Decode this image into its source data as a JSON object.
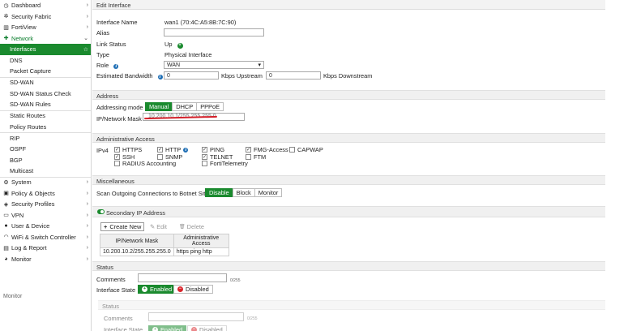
{
  "sidebar": {
    "items": [
      {
        "label": "Dashboard",
        "icon": "dashboard-icon",
        "glyph": "◷",
        "chev": "›"
      },
      {
        "label": "Security Fabric",
        "icon": "fabric-icon",
        "glyph": "✲",
        "chev": "›"
      },
      {
        "label": "FortiView",
        "icon": "chart-icon",
        "glyph": "▥",
        "chev": "›"
      },
      {
        "label": "Network",
        "icon": "network-plus-icon",
        "glyph": "✚",
        "chev": "⌄"
      },
      {
        "label": "Interfaces",
        "star": "☆"
      },
      {
        "label": "DNS"
      },
      {
        "label": "Packet Capture"
      },
      {
        "label": "SD-WAN"
      },
      {
        "label": "SD-WAN Status Check"
      },
      {
        "label": "SD-WAN Rules"
      },
      {
        "label": "Static Routes"
      },
      {
        "label": "Policy Routes"
      },
      {
        "label": "RIP"
      },
      {
        "label": "OSPF"
      },
      {
        "label": "BGP"
      },
      {
        "label": "Multicast"
      },
      {
        "label": "System",
        "icon": "gear-icon",
        "glyph": "⚙",
        "chev": "›"
      },
      {
        "label": "Policy & Objects",
        "icon": "policy-icon",
        "glyph": "▣",
        "chev": "›"
      },
      {
        "label": "Security Profiles",
        "icon": "shield-icon",
        "glyph": "◈",
        "chev": "›"
      },
      {
        "label": "VPN",
        "icon": "monitor-icon",
        "glyph": "▭",
        "chev": "›"
      },
      {
        "label": "User & Device",
        "icon": "user-icon",
        "glyph": "●",
        "chev": "›"
      },
      {
        "label": "WiFi & Switch Controller",
        "icon": "wifi-icon",
        "glyph": "◠",
        "chev": "›"
      },
      {
        "label": "Log & Report",
        "icon": "bar-chart-icon",
        "glyph": "▤",
        "chev": "›"
      },
      {
        "label": "Monitor",
        "icon": "gauge-icon",
        "glyph": "◕",
        "chev": "›"
      }
    ],
    "ghost_monitor": "Monitor"
  },
  "edit": {
    "title": "Edit Interface",
    "interface_name_label": "Interface Name",
    "interface_name_value": "wan1 (70:4C:A5:8B:7C:90)",
    "alias_label": "Alias",
    "alias_value": "",
    "link_status_label": "Link Status",
    "link_status_value": "Up",
    "type_label": "Type",
    "type_value": "Physical Interface",
    "role_label": "Role",
    "role_value": "WAN",
    "bandwidth_label": "Estimated Bandwidth",
    "upstream_value": "0",
    "upstream_unit": "Kbps Upstream",
    "downstream_value": "0",
    "downstream_unit": "Kbps Downstream"
  },
  "address": {
    "section": "Address",
    "mode_label": "Addressing mode",
    "modes": [
      "Manual",
      "DHCP",
      "PPPoE"
    ],
    "ipmask_label": "IP/Network Mask",
    "ipmask_value": "10.200.10.1/255.255.255.0"
  },
  "admin": {
    "section": "Administrative Access",
    "ipv4_label": "IPv4",
    "checks": [
      {
        "label": "HTTPS",
        "checked": true
      },
      {
        "label": "HTTP",
        "checked": true,
        "info": true
      },
      {
        "label": "PING",
        "checked": true
      },
      {
        "label": "FMG-Access",
        "checked": true
      },
      {
        "label": "CAPWAP",
        "checked": false
      },
      {
        "label": "SSH",
        "checked": true
      },
      {
        "label": "SNMP",
        "checked": false
      },
      {
        "label": "TELNET",
        "checked": true
      },
      {
        "label": "FTM",
        "checked": false
      },
      {
        "label": "RADIUS Accounting",
        "checked": false
      },
      {
        "label": "FortiTelemetry",
        "checked": false
      }
    ],
    "check_mark": "✓"
  },
  "misc": {
    "section": "Miscellaneous",
    "botnet_label": "Scan Outgoing Connections to Botnet Sites",
    "options": [
      "Disable",
      "Block",
      "Monitor"
    ]
  },
  "secondary": {
    "section": "Secondary IP Address",
    "create_label": "Create New",
    "edit_label": "Edit",
    "delete_label": "Delete",
    "plus": "+",
    "pencil": "✎",
    "trash": "🗑",
    "columns": [
      "IP/Network Mask",
      "Administrative Access"
    ],
    "rows": [
      [
        "10.200.10.2/255.255.255.0",
        "https ping http"
      ]
    ]
  },
  "status": {
    "section": "Status",
    "comments_label": "Comments",
    "comments_counter": "0/255",
    "state_label": "Interface State",
    "enabled_label": "Enabled",
    "disabled_label": "Disabled",
    "plus": "+",
    "minus": "−"
  },
  "colors": {
    "accent": "#1a8a2e",
    "danger": "#d9262c",
    "info": "#1f6fb5"
  }
}
